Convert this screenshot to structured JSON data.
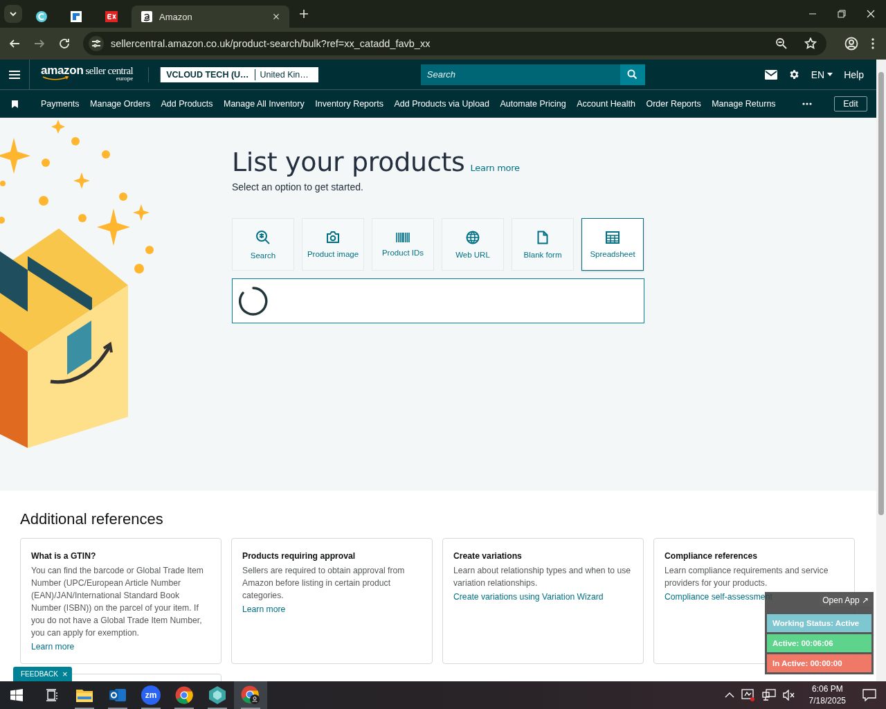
{
  "browser": {
    "tabs": [
      {
        "selected": false
      },
      {
        "selected": false
      },
      {
        "selected": false
      },
      {
        "title": "Amazon",
        "selected": true
      }
    ],
    "url": "sellercentral.amazon.co.uk/product-search/bulk?ref=xx_catadd_favb_xx"
  },
  "header": {
    "logo": "amazon",
    "logo_product": "seller central",
    "logo_region": "europe",
    "account": "VCLOUD TECH (U…",
    "marketplace": "United Kin…",
    "search": {
      "placeholder": "Search"
    },
    "language": "EN",
    "help": "Help"
  },
  "nav": {
    "items": [
      "Payments",
      "Manage Orders",
      "Add Products",
      "Manage All Inventory",
      "Inventory Reports",
      "Add Products via Upload",
      "Automate Pricing",
      "Account Health",
      "Order Reports",
      "Manage Returns"
    ],
    "edit": "Edit"
  },
  "main": {
    "title": "List your products",
    "learn_more": "Learn more",
    "subtitle": "Select an option to get started.",
    "options": [
      {
        "kind": "search",
        "label": "Search",
        "selected": false
      },
      {
        "kind": "camera",
        "label": "Product image",
        "selected": false
      },
      {
        "kind": "barcode",
        "label": "Product IDs",
        "selected": false
      },
      {
        "kind": "globe",
        "label": "Web URL",
        "selected": false
      },
      {
        "kind": "document",
        "label": "Blank form",
        "selected": false
      },
      {
        "kind": "table",
        "label": "Spreadsheet",
        "selected": true
      }
    ],
    "loading": true
  },
  "references": {
    "title": "Additional references",
    "cards": [
      {
        "title": "What is a GTIN?",
        "body": "You can find the barcode or Global Trade Item Number (UPC/European Article Number (EAN)/JAN/International Standard Book Number (ISBN)) on the parcel of your item. If you do not have a Global Trade Item Number, you can apply for exemption.",
        "link": "Learn more"
      },
      {
        "title": "Products requiring approval",
        "body": "Sellers are required to obtain approval from Amazon before listing in certain product categories.",
        "link": "Learn more"
      },
      {
        "title": "Create variations",
        "body": "Learn about relationship types and when to use variation relationships.",
        "link": "Create variations using Variation Wizard"
      },
      {
        "title": "Compliance references",
        "body": "Learn compliance requirements and service providers for your products.",
        "link": "Compliance self-assessment"
      }
    ]
  },
  "feedback": {
    "label": "FEEDBACK",
    "close": "×"
  },
  "status_widget": {
    "open_app": "Open App ↗",
    "rows": [
      {
        "text": "Working Status: Active",
        "color": "#7ec6d0"
      },
      {
        "text": "Active: 00:06:06",
        "color": "#5dd38b"
      },
      {
        "text": "In Active: 00:00:00",
        "color": "#ef7866"
      }
    ]
  },
  "taskbar": {
    "apps": [
      {
        "kind": "explorer",
        "selected": false
      },
      {
        "kind": "outlook",
        "selected": false
      },
      {
        "kind": "zoom",
        "label": "zm",
        "selected": false
      },
      {
        "kind": "chrome",
        "selected": false
      },
      {
        "kind": "cube",
        "selected": false
      },
      {
        "kind": "chrome-profile",
        "selected": true
      }
    ],
    "time": "6:06 PM",
    "date": "7/18/2025"
  }
}
